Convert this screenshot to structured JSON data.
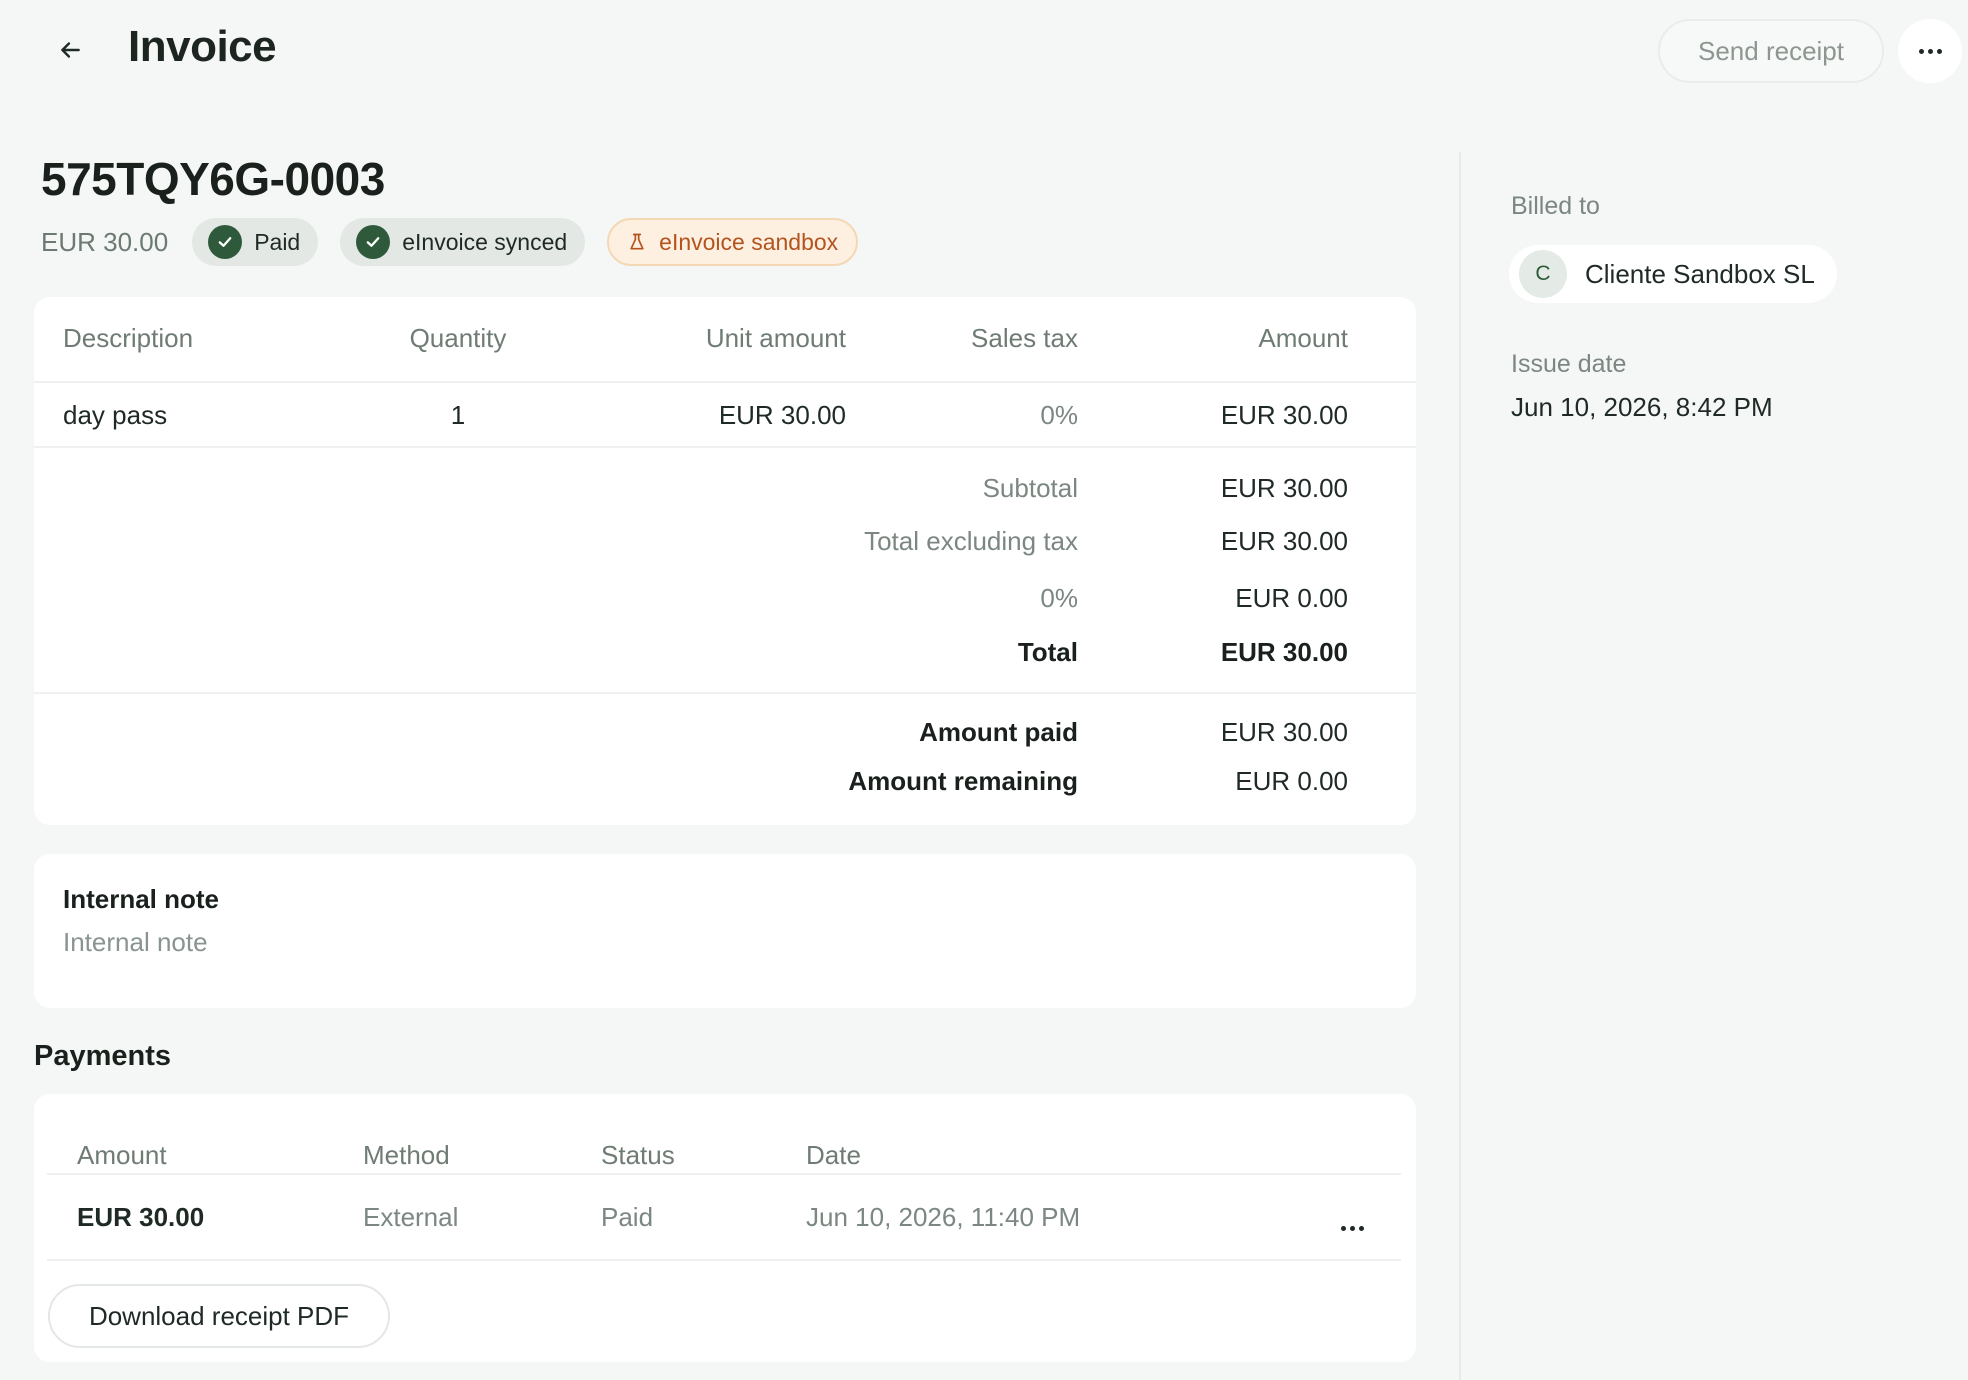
{
  "header": {
    "title": "Invoice",
    "send_receipt_label": "Send receipt"
  },
  "invoice": {
    "number": "575TQY6G-0003",
    "amount": "EUR 30.00",
    "badges": {
      "paid": "Paid",
      "einvoice_synced": "eInvoice synced",
      "einvoice_sandbox": "eInvoice sandbox"
    },
    "line_items": {
      "columns": [
        "Description",
        "Quantity",
        "Unit amount",
        "Sales tax",
        "Amount"
      ],
      "rows": [
        {
          "description": "day pass",
          "quantity": "1",
          "unit_amount": "EUR 30.00",
          "sales_tax": "0%",
          "amount": "EUR 30.00"
        }
      ]
    },
    "totals": {
      "subtotal_label": "Subtotal",
      "subtotal_value": "EUR 30.00",
      "excl_tax_label": "Total excluding tax",
      "excl_tax_value": "EUR 30.00",
      "tax_label": "0%",
      "tax_value": "EUR 0.00",
      "total_label": "Total",
      "total_value": "EUR 30.00",
      "paid_label": "Amount paid",
      "paid_value": "EUR 30.00",
      "remaining_label": "Amount remaining",
      "remaining_value": "EUR 0.00"
    }
  },
  "internal_note": {
    "title": "Internal note",
    "placeholder": "Internal note"
  },
  "payments": {
    "heading": "Payments",
    "columns": [
      "Amount",
      "Method",
      "Status",
      "Date"
    ],
    "rows": [
      {
        "amount": "EUR 30.00",
        "method": "External",
        "status": "Paid",
        "date": "Jun 10, 2026, 11:40 PM"
      }
    ],
    "download_label": "Download receipt PDF"
  },
  "sidebar": {
    "billed_to_label": "Billed to",
    "customer_initial": "C",
    "customer_name": "Cliente Sandbox SL",
    "issue_date_label": "Issue date",
    "issue_date_value": "Jun 10, 2026, 8:42 PM"
  },
  "icons": {
    "back": "arrow-left-icon",
    "more": "more-horizontal-icon",
    "check": "check-icon",
    "flask": "flask-icon"
  },
  "colors": {
    "background": "#f5f7f6",
    "brand_green": "#2e5a3b",
    "sandbox_orange": "#b4531e"
  }
}
